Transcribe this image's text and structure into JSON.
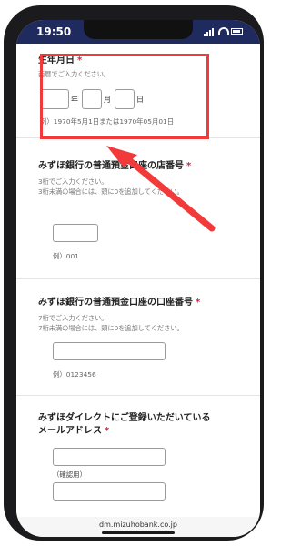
{
  "status_bar": {
    "time": "19:50"
  },
  "birthdate": {
    "title": "生年月日",
    "required_mark": "*",
    "hint": "西暦でご入力ください。",
    "year_unit": "年",
    "month_unit": "月",
    "day_unit": "日",
    "example": "例）1970年5月1日または1970年05月01日"
  },
  "branch_number": {
    "title": "みずほ銀行の普通預金口座の店番号",
    "required_mark": "*",
    "hint1": "3桁でご入力ください。",
    "hint2": "3桁未満の場合には、頭に0を追加してください。",
    "example": "例）001"
  },
  "account_number": {
    "title": "みずほ銀行の普通預金口座の口座番号",
    "required_mark": "*",
    "hint1": "7桁でご入力ください。",
    "hint2": "7桁未満の場合には、頭に0を追加してください。",
    "example": "例）0123456"
  },
  "email": {
    "title_line1": "みずほダイレクトにご登録いただいている",
    "title_line2": "メールアドレス",
    "required_mark": "*",
    "confirm_label": "（確認用）"
  },
  "footer": {
    "url": "dm.mizuhobank.co.jp"
  },
  "colors": {
    "status_bar": "#1f2a5f",
    "required": "#d9243b",
    "highlight": "#f23a3a"
  }
}
